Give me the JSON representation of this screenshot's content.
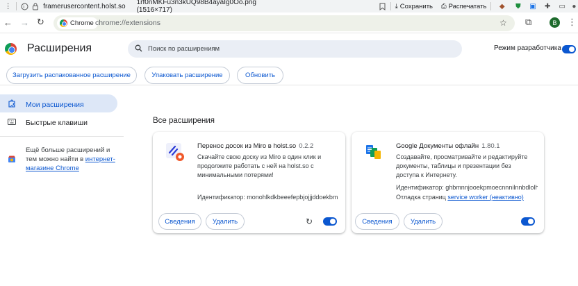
{
  "viewer": {
    "domain": "framerusercontent.holst.so",
    "filename": "1rf0nMKFu3n3kUQ98B4ayaIg0Oo.png (1516×717)",
    "save_label": "Сохранить",
    "print_label": "Распечатать",
    "profile_initial": "B"
  },
  "omnibox": {
    "chip_label": "Chrome",
    "url": "chrome://extensions"
  },
  "header": {
    "title": "Расширения",
    "search_placeholder": "Поиск по расширениям",
    "dev_mode_label": "Режим разработчика",
    "dev_mode_on": true
  },
  "actions": {
    "load_unpacked": "Загрузить распакованное расширение",
    "pack": "Упаковать расширение",
    "update": "Обновить"
  },
  "sidebar": {
    "items": [
      {
        "label": "Мои расширения",
        "icon": "puzzle-icon",
        "active": true
      },
      {
        "label": "Быстрые клавиши",
        "icon": "keyboard-icon",
        "active": false
      }
    ],
    "note_text": "Ещё больше расширений и тем можно найти в ",
    "note_link": "интернет-магазине Chrome"
  },
  "main": {
    "section_title": "Все расширения",
    "cards": [
      {
        "name": "Перенос досок из Miro в holst.so",
        "version": "0.2.2",
        "description": "Скачайте свою доску из Miro в один клик и продолжите работать с ней на holst.so с минимальными потерями!",
        "id_label": "Идентификатор: monohlkdkbeeefepbjojjjddoekbmclbf",
        "details_label": "Сведения",
        "remove_label": "Удалить",
        "enabled": true
      },
      {
        "name": "Google Документы офлайн",
        "version": "1.80.1",
        "description": "Создавайте, просматривайте и редактируйте документы, таблицы и презентации без доступа к Интернету.",
        "id_label": "Идентификатор: ghbmnnjooekpmoecnnnilnnbdlolhkhi",
        "inspect_label": "Отладка страниц",
        "inspect_link": "service worker (неактивно)",
        "details_label": "Сведения",
        "remove_label": "Удалить",
        "enabled": true
      }
    ]
  },
  "colors": {
    "accent": "#0b57d0",
    "active_bg": "#dde7f7"
  }
}
